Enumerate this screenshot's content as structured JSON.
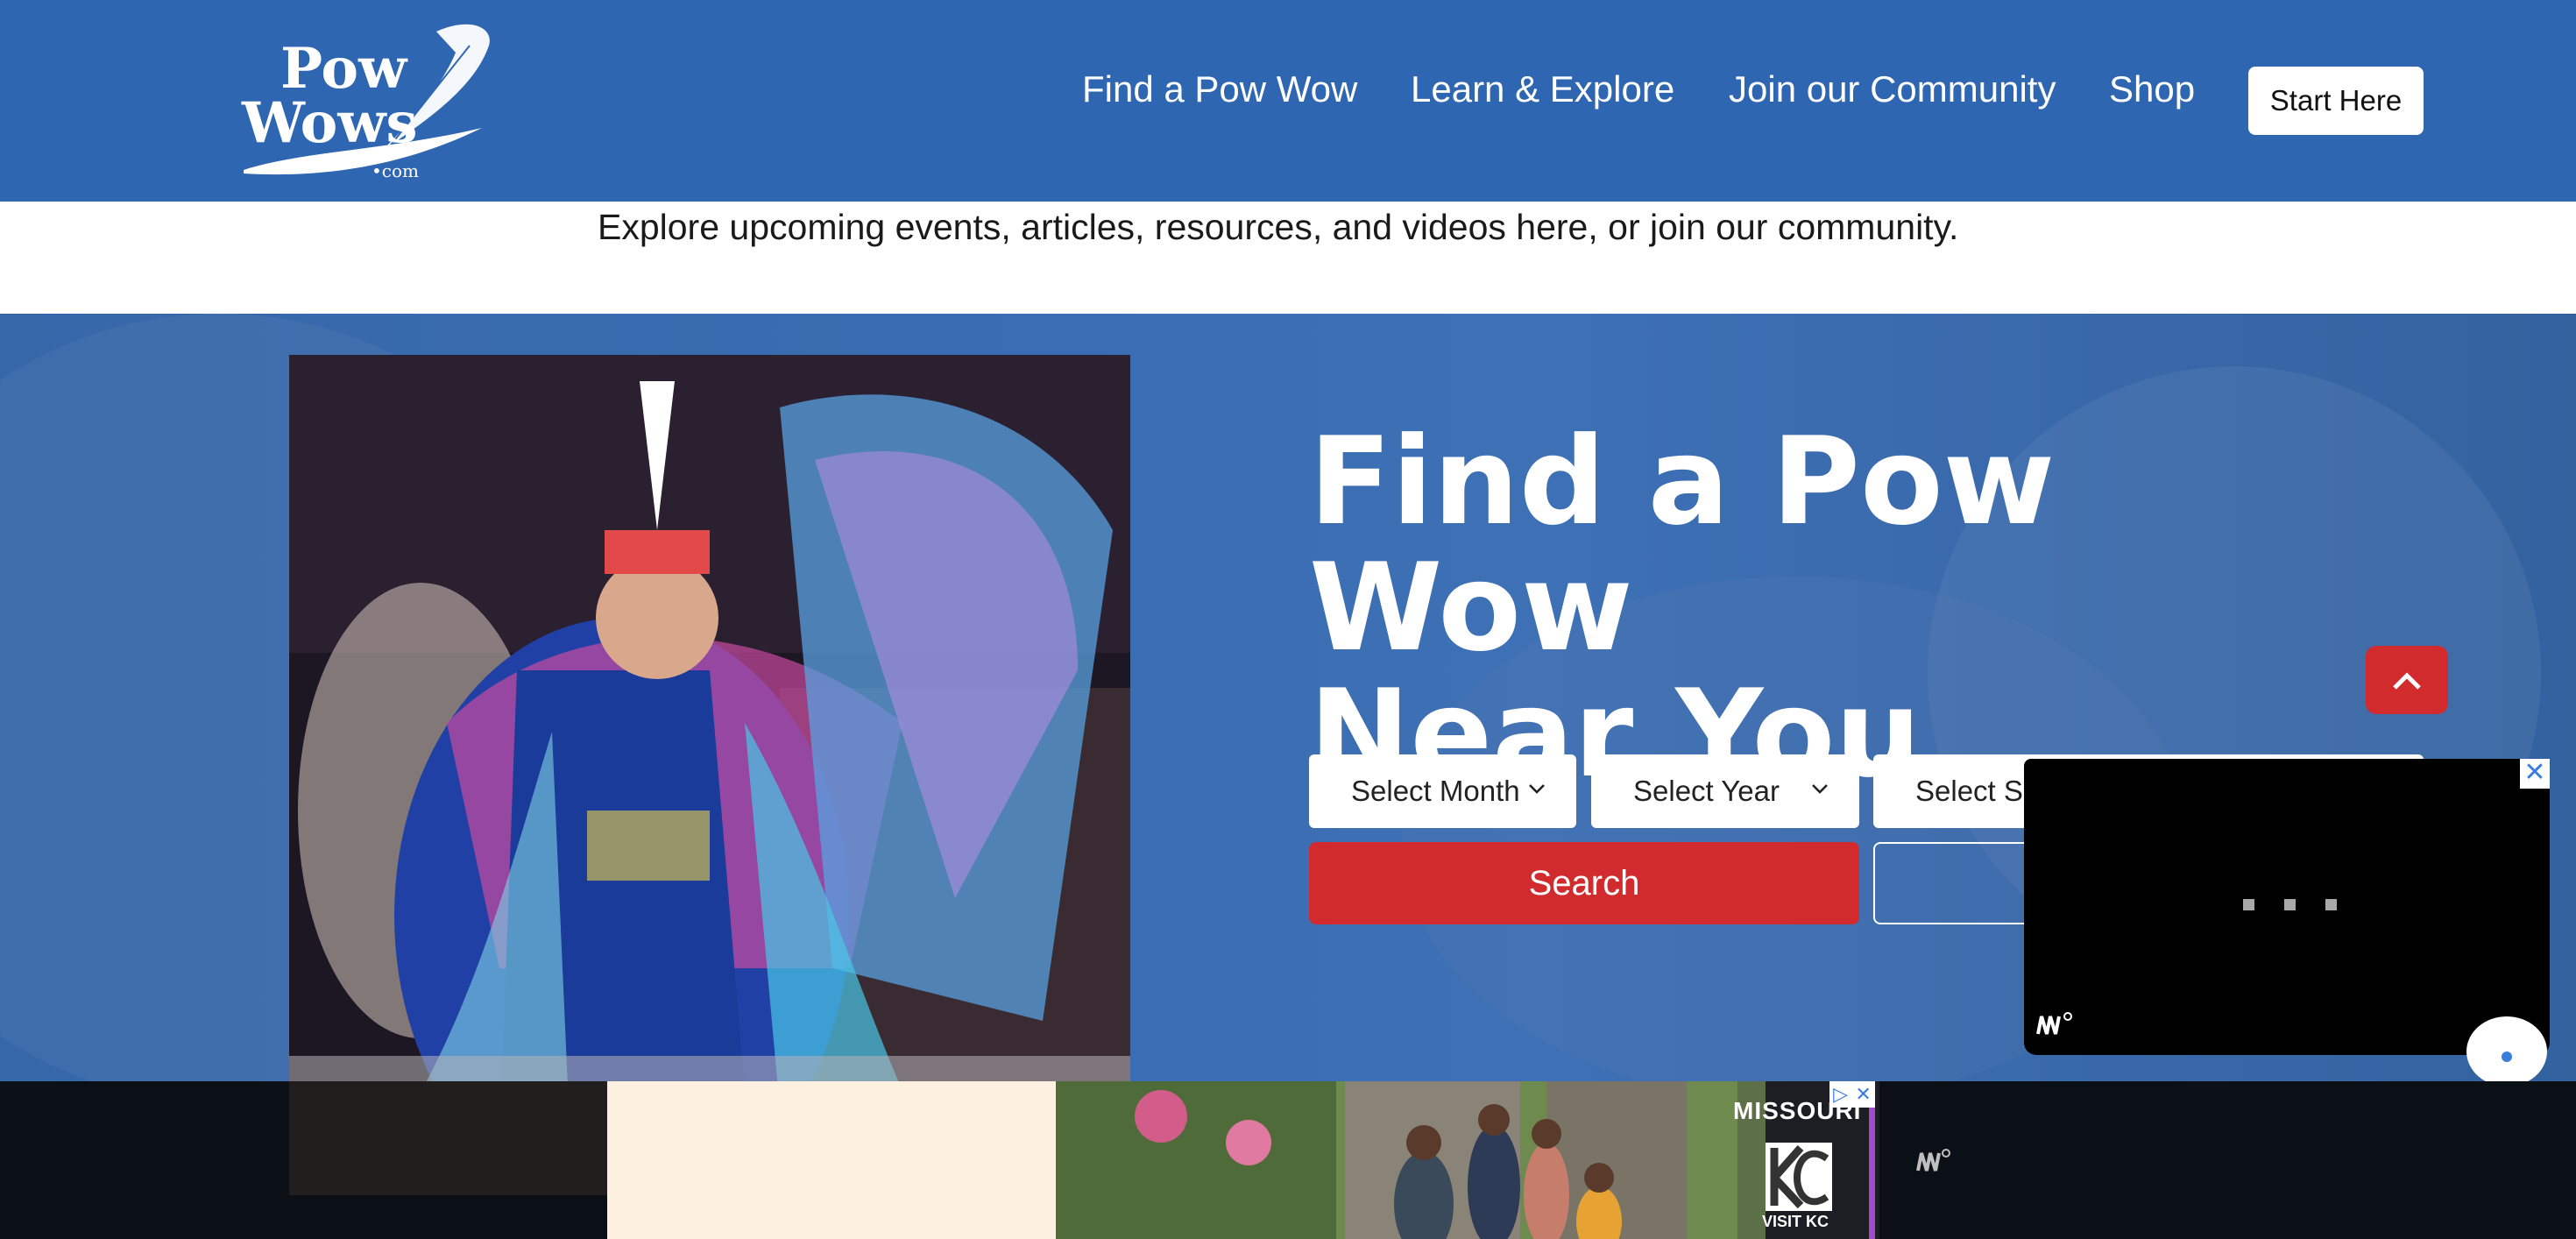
{
  "header": {
    "logo": {
      "line1": "Pow",
      "line2": "Wows",
      "suffix": "•com"
    },
    "nav": [
      {
        "label": "Find a Pow Wow"
      },
      {
        "label": "Learn & Explore"
      },
      {
        "label": "Join our Community"
      },
      {
        "label": "Shop"
      }
    ],
    "start_button": "Start Here"
  },
  "tagline": "Explore upcoming events, articles, resources, and videos here, or join our community.",
  "hero": {
    "title_line1": "Find a Pow Wow",
    "title_line2": "Near You",
    "filters": {
      "month": "Select Month",
      "year": "Select Year",
      "state": "Select S"
    },
    "search_button": "Search"
  },
  "video_ad": {
    "close_label": "✕"
  },
  "bottom_ad": {
    "brand_top": "MISSOURI",
    "brand_bottom": "VISIT KC",
    "choices": [
      "▷",
      "✕"
    ]
  },
  "colors": {
    "header_blue": "#2f66b1",
    "accent_red": "#d12b2e",
    "white": "#ffffff"
  },
  "icons": {
    "scroll_top": "chevron-up-icon",
    "select": "chevron-down-icon",
    "close": "close-icon"
  }
}
